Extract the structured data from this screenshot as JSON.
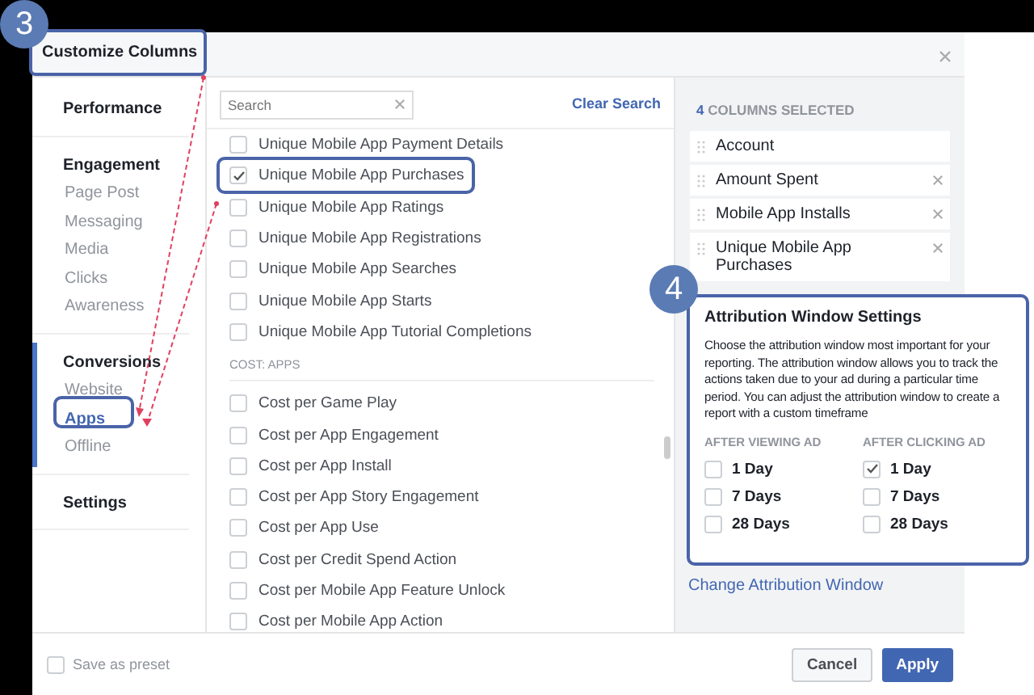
{
  "badges": [
    {
      "label": "3"
    },
    {
      "label": "4"
    }
  ],
  "dialog": {
    "title": "Customize Columns",
    "nav": [
      {
        "label": "Performance",
        "selected": false
      },
      {
        "label": "Engagement",
        "selected": false,
        "items": [
          {
            "label": "Page Post",
            "selected": false
          },
          {
            "label": "Messaging",
            "selected": false
          },
          {
            "label": "Media",
            "selected": false
          },
          {
            "label": "Clicks",
            "selected": false
          },
          {
            "label": "Awareness",
            "selected": false
          }
        ]
      },
      {
        "label": "Conversions",
        "selected": true,
        "items": [
          {
            "label": "Website",
            "selected": false
          },
          {
            "label": "Apps",
            "selected": true
          },
          {
            "label": "Offline",
            "selected": false
          }
        ]
      },
      {
        "label": "Settings",
        "selected": false
      }
    ],
    "search": {
      "placeholder": "Search"
    },
    "clear_search": "Clear Search",
    "metrics": [
      {
        "kind": "option",
        "label": "Unique Mobile App Payment Details",
        "checked": false
      },
      {
        "kind": "option",
        "label": "Unique Mobile App Purchases",
        "checked": true
      },
      {
        "kind": "option",
        "label": "Unique Mobile App Ratings",
        "checked": false
      },
      {
        "kind": "option",
        "label": "Unique Mobile App Registrations",
        "checked": false
      },
      {
        "kind": "option",
        "label": "Unique Mobile App Searches",
        "checked": false
      },
      {
        "kind": "option",
        "label": "Unique Mobile App Starts",
        "checked": false
      },
      {
        "kind": "option",
        "label": "Unique Mobile App Tutorial Completions",
        "checked": false
      },
      {
        "kind": "header",
        "label": "COST: APPS"
      },
      {
        "kind": "option",
        "label": "Cost per Game Play",
        "checked": false
      },
      {
        "kind": "option",
        "label": "Cost per App Engagement",
        "checked": false
      },
      {
        "kind": "option",
        "label": "Cost per App Install",
        "checked": false
      },
      {
        "kind": "option",
        "label": "Cost per App Story Engagement",
        "checked": false
      },
      {
        "kind": "option",
        "label": "Cost per App Use",
        "checked": false
      },
      {
        "kind": "option",
        "label": "Cost per Credit Spend Action",
        "checked": false
      },
      {
        "kind": "option",
        "label": "Cost per Mobile App Feature Unlock",
        "checked": false
      },
      {
        "kind": "option",
        "label": "Cost per Mobile App Action",
        "checked": false
      }
    ],
    "selected_count": "4",
    "selected_heading": "COLUMNS SELECTED",
    "selected_columns": [
      {
        "label": "Account",
        "removable": false
      },
      {
        "label": "Amount Spent",
        "removable": true
      },
      {
        "label": "Mobile App Installs",
        "removable": true
      },
      {
        "label": "Unique Mobile App Purchases",
        "removable": true
      }
    ],
    "attribution": {
      "title": "Attribution Window Settings",
      "description": "Choose the attribution window most important for your reporting. The attribution window allows you to track the actions taken due to your ad during a particular time period. You can adjust the attribution window to create a report with a custom timeframe",
      "groups": [
        {
          "heading": "AFTER VIEWING AD",
          "options": [
            {
              "label": "1 Day",
              "checked": false
            },
            {
              "label": "7 Days",
              "checked": false
            },
            {
              "label": "28 Days",
              "checked": false
            }
          ]
        },
        {
          "heading": "AFTER CLICKING AD",
          "options": [
            {
              "label": "1 Day",
              "checked": true
            },
            {
              "label": "7 Days",
              "checked": false
            },
            {
              "label": "28 Days",
              "checked": false
            }
          ]
        }
      ]
    },
    "change_link": "Change Attribution Window",
    "save_preset": {
      "label": "Save as preset",
      "checked": false
    },
    "buttons": [
      {
        "label": "Cancel",
        "kind": "secondary"
      },
      {
        "label": "Apply",
        "kind": "primary"
      }
    ]
  }
}
